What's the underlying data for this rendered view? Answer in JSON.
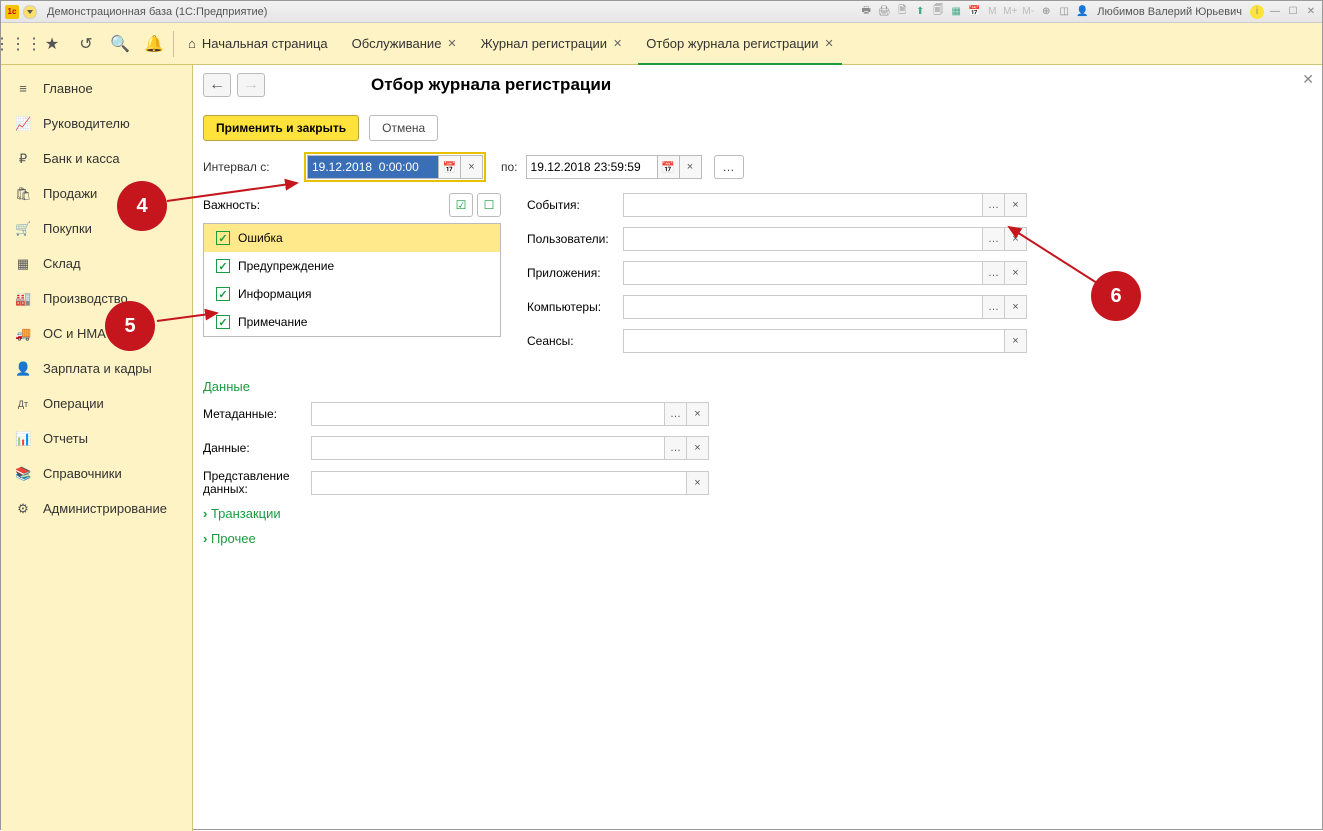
{
  "titlebar": {
    "app_title": "Демонстрационная база  (1С:Предприятие)",
    "user": "Любимов Валерий Юрьевич",
    "m_labels": [
      "M",
      "M+",
      "M-"
    ]
  },
  "tabs": {
    "home": "Начальная страница",
    "t1": "Обслуживание",
    "t2": "Журнал регистрации",
    "t3": "Отбор журнала регистрации"
  },
  "sidebar": {
    "items": [
      {
        "icon": "≡",
        "label": "Главное"
      },
      {
        "icon": "📈",
        "label": "Руководителю"
      },
      {
        "icon": "₽",
        "label": "Банк и касса"
      },
      {
        "icon": "🛍",
        "label": "Продажи"
      },
      {
        "icon": "🛒",
        "label": "Покупки"
      },
      {
        "icon": "▦",
        "label": "Склад"
      },
      {
        "icon": "🏭",
        "label": "Производство"
      },
      {
        "icon": "🚚",
        "label": "ОС и НМА"
      },
      {
        "icon": "👤",
        "label": "Зарплата и кадры"
      },
      {
        "icon": "Дт",
        "label": "Операции"
      },
      {
        "icon": "📊",
        "label": "Отчеты"
      },
      {
        "icon": "📚",
        "label": "Справочники"
      },
      {
        "icon": "⚙",
        "label": "Администрирование"
      }
    ]
  },
  "page": {
    "title": "Отбор журнала регистрации",
    "apply_close": "Применить и закрыть",
    "cancel": "Отмена",
    "interval_from": "Интервал с:",
    "date_from": "19.12.2018  0:00:00",
    "to": "по:",
    "date_to": "19.12.2018 23:59:59",
    "importance": "Важность:",
    "imp_items": [
      "Ошибка",
      "Предупреждение",
      "Информация",
      "Примечание"
    ],
    "r_labels": {
      "events": "События:",
      "users": "Пользователи:",
      "apps": "Приложения:",
      "comps": "Компьютеры:",
      "sessions": "Сеансы:"
    },
    "section_data": "Данные",
    "meta": {
      "metadata": "Метаданные:",
      "data": "Данные:",
      "repr": "Представление данных:"
    },
    "exp1": "Транзакции",
    "exp2": "Прочее"
  },
  "annotations": {
    "b4": "4",
    "b5": "5",
    "b6": "6"
  }
}
